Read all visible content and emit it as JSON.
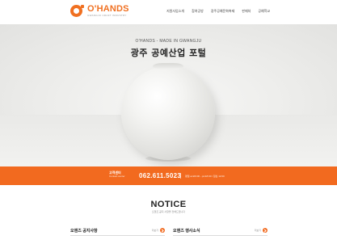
{
  "header": {
    "logo_word": "O'HANDS",
    "logo_sub": "GWANGJU CRAFT INDUSTRY",
    "nav": [
      "지원사업소개",
      "참여공방",
      "광주공예문화축제",
      "판매처",
      "공예학교"
    ]
  },
  "hero": {
    "kicker": "O'HANDS - MADE IN GWANGJU",
    "title": "광주 공예산업 포털"
  },
  "contact": {
    "label_ko": "고객센터",
    "label_en": "Contact center",
    "phone": "062.611.5023",
    "hours": "평일 am09:00 - pm18:00 / 점심 12:00"
  },
  "notice": {
    "title": "NOTICE",
    "subtitle": "오핸즈 공지 사항을 전해드립니다"
  },
  "panels": [
    {
      "title": "오핸즈 공지사항",
      "more": "더보기"
    },
    {
      "title": "오핸즈 행사소식",
      "more": "더보기"
    }
  ],
  "colors": {
    "accent": "#f26a1f"
  }
}
